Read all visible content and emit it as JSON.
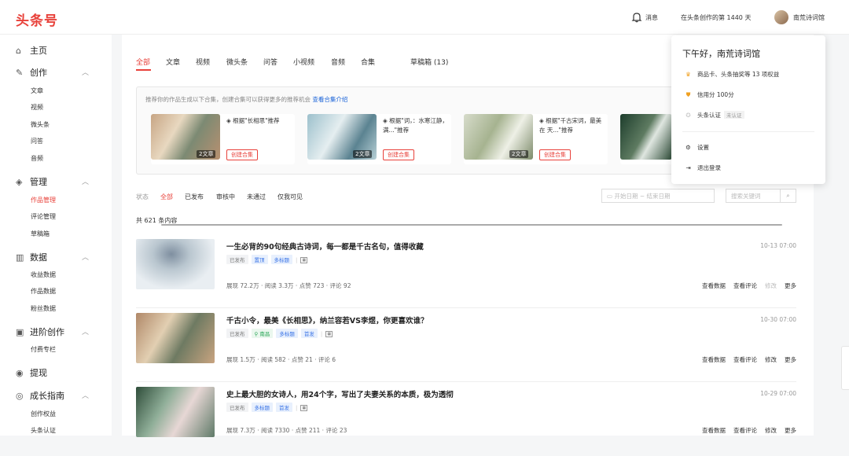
{
  "topbar": {
    "logo": "头条号",
    "message": "消息",
    "days": "在头条创作的第 1440 天",
    "username": "南荒诗词馆"
  },
  "sidebar": {
    "home": "主页",
    "create": {
      "label": "创作",
      "items": [
        "文章",
        "视频",
        "微头条",
        "问答",
        "音频"
      ]
    },
    "manage": {
      "label": "管理",
      "items": [
        "作品管理",
        "评论管理",
        "草稿箱"
      ]
    },
    "data": {
      "label": "数据",
      "items": [
        "收益数据",
        "作品数据",
        "粉丝数据"
      ]
    },
    "advanced": {
      "label": "进阶创作",
      "items": [
        "付费专栏"
      ]
    },
    "withdraw": "提现",
    "guide": {
      "label": "成长指南",
      "items": [
        "创作权益",
        "头条认证"
      ]
    }
  },
  "tabs": [
    "全部",
    "文章",
    "视频",
    "微头条",
    "问答",
    "小视频",
    "音频",
    "合集",
    "草稿箱 (13)"
  ],
  "recommend": {
    "tip": "推荐你的作品生成以下合集，创建合集可以获得更多的推荐机会",
    "link": "查看合集介绍",
    "cards": [
      {
        "title": "根据\"长相思\"推荐",
        "count": "2文章",
        "button": "创建合集"
      },
      {
        "title": "根据\"词，：水寒江静，满...\"推荐",
        "count": "2文章",
        "button": "创建合集"
      },
      {
        "title": "根据\"千古宋词，最美在 天...\"推荐",
        "count": "2文章",
        "button": "创建合集"
      }
    ]
  },
  "filters": {
    "label": "状态",
    "items": [
      "全部",
      "已发布",
      "审核中",
      "未通过",
      "仅我可见"
    ],
    "start_date": "开始日期",
    "end_date": "结束日期",
    "search_placeholder": "搜索关键词"
  },
  "total": "共 621 条内容",
  "articles": [
    {
      "title": "一生必背的90句经典古诗词，每一都是千古名句，值得收藏",
      "tags": [
        "已发布",
        "置顶",
        "多标题"
      ],
      "stats": "展现 72.2万 · 阅读 3.3万 · 点赞 723 · 评论 92",
      "time": "10-13 07:00",
      "actions": [
        "查看数据",
        "查看评论",
        "修改",
        "更多"
      ]
    },
    {
      "title": "千古小令，最美《长相思》，纳兰容若VS李煜，你更喜欢谁？",
      "tags": [
        "已发布",
        "南昌",
        "多标题",
        "首发"
      ],
      "stats": "展现 1.5万 · 阅读 582 · 点赞 21 · 评论 6",
      "time": "10-30 07:00",
      "actions": [
        "查看数据",
        "查看评论",
        "修改",
        "更多"
      ]
    },
    {
      "title": "史上最大胆的女诗人，用24个字，写出了夫妻关系的本质，极为透彻",
      "tags": [
        "已发布",
        "多标题",
        "首发"
      ],
      "stats": "展现 7.3万 · 阅读 7330 · 点赞 211 · 评论 23",
      "time": "10-29 07:00",
      "actions": [
        "查看数据",
        "查看评论",
        "修改",
        "更多"
      ]
    }
  ],
  "popup": {
    "greeting": "下午好，南荒诗词馆",
    "rights": "商品卡、头条抽奖等 13 项权益",
    "credit": "信用分  100分",
    "verify": "头条认证",
    "verify_badge": "未认证",
    "settings": "设置",
    "logout": "退出登录"
  }
}
